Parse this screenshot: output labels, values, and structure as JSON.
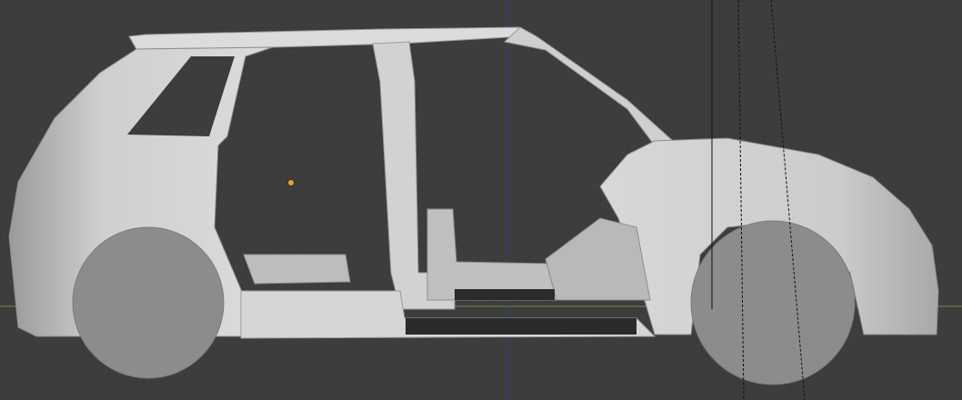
{
  "viewport": {
    "view": "",
    "background_color": "#3d3d3d",
    "grid_color": "#363636",
    "x_axis_color": "#6a8a4a",
    "z_axis_color": "#2e3a8a"
  },
  "model": {
    "object": "car-body",
    "body_color": "#cfcfcf",
    "shadow_color": "#8a8a8a",
    "wheel_color": "#8c8c8c",
    "floor_color": "#2b2b2b",
    "origin_color": "#e0a050"
  },
  "overlays": {
    "camera_lines": "dashed",
    "line_color": "#111111"
  }
}
